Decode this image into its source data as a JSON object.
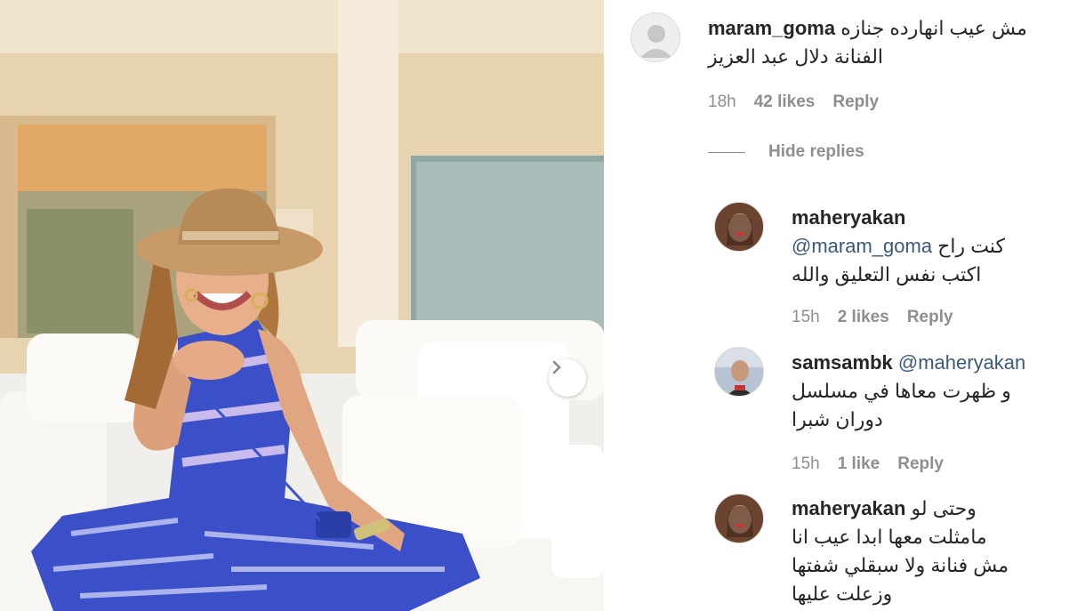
{
  "post": {
    "next_icon": "chevron-right-icon"
  },
  "comments": [
    {
      "username": "maram_goma",
      "line1": "مش عيب انهارده جنازه",
      "line2": "الفنانة دلال عبد العزيز",
      "time": "18h",
      "likes": "42 likes",
      "reply": "Reply",
      "avatar": "default-avatar"
    }
  ],
  "hide_replies": "Hide replies",
  "replies": [
    {
      "username": "maheryakan",
      "mention": "@maram_goma",
      "line1_before": "كنت راح",
      "line2": "اكتب نفس التعليق والله",
      "time": "15h",
      "likes": "2 likes",
      "reply": "Reply"
    },
    {
      "username": "samsambk",
      "mention": "@maheryakan",
      "line2": "و ظهرت معاها في مسلسل",
      "line3": "دوران شبرا",
      "time": "15h",
      "likes": "1 like",
      "reply": "Reply"
    },
    {
      "username": "maheryakan",
      "line1": "وحتى لو",
      "line2": "مامثلت معها ابدا عيب انا",
      "line3": "مش فنانة ولا سبقلي شفتها",
      "line4": "وزعلت عليها"
    }
  ],
  "colors": {
    "meta_gray": "#8e8e8e",
    "text": "#262626",
    "mention": "#3b5a7a"
  }
}
